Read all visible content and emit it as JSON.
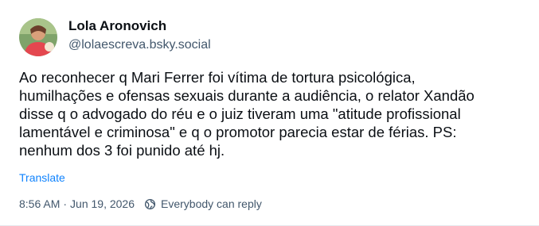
{
  "post": {
    "author": {
      "display_name": "Lola Aronovich",
      "handle": "@lolaescreva.bsky.social"
    },
    "text_lines": [
      "Ao reconhecer q Mari Ferrer foi vítima de tortura psicológica,",
      "humilhações e ofensas sexuais durante a audiência, o relator Xandão",
      "disse q o advogado do réu e o juiz tiveram uma \"atitude profissional",
      "lamentável e criminosa\" e q o promotor parecia estar de férias. PS:",
      "nenhum dos 3 foi punido até hj."
    ],
    "translate_label": "Translate",
    "time": "8:56 AM",
    "separator": "·",
    "date": "Jun 19, 2026",
    "reply_setting": "Everybody can reply"
  },
  "colors": {
    "text": "#0b0f14",
    "secondary": "#42576c",
    "link": "#1083fe"
  },
  "icons": {
    "reply_setting": "globe-icon"
  }
}
